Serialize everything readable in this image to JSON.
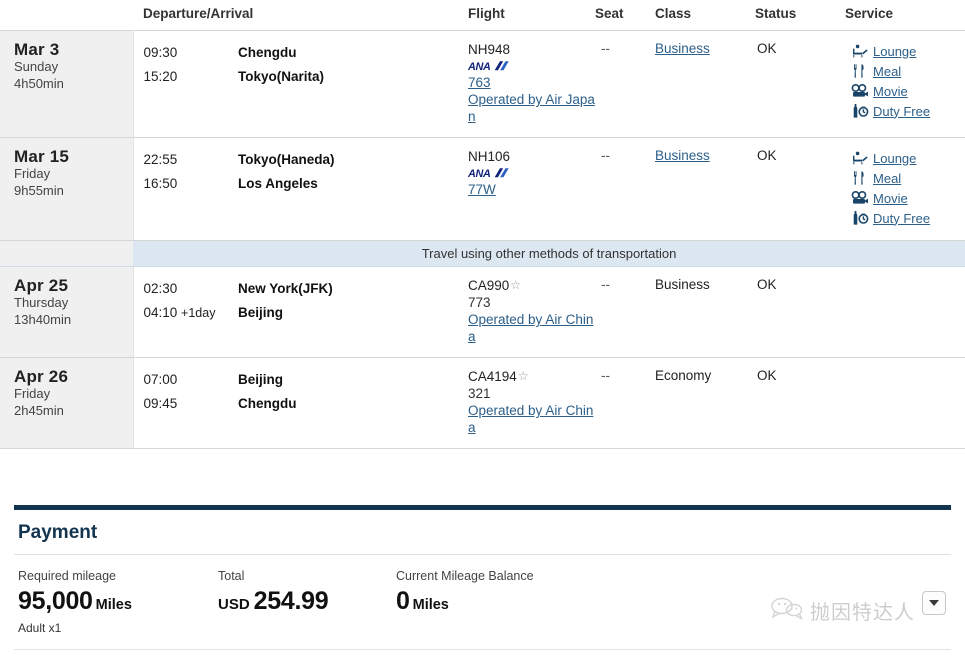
{
  "table": {
    "columns": {
      "date": "",
      "departure_arrival": "Departure/Arrival",
      "flight": "Flight",
      "seat": "Seat",
      "class": "Class",
      "status": "Status",
      "service": "Service"
    },
    "other_transport_note": "Travel using other methods of transportation",
    "segments": [
      {
        "date": "Mar 3",
        "weekday": "Sunday",
        "duration": "4h50min",
        "depart_time": "09:30",
        "arrive_time": "15:20",
        "arrive_day_offset": "",
        "depart_city": "Chengdu",
        "arrive_city": "Tokyo(Narita)",
        "flight_number": "NH948",
        "carrier_logo": "ana-logo",
        "star_alliance": false,
        "equipment": "763",
        "equipment_is_link": true,
        "operated_by": "Operated by Air Japan",
        "seat": "--",
        "class": "Business",
        "class_is_link": true,
        "status": "OK",
        "services": [
          {
            "icon": "lounge-icon",
            "label": "Lounge"
          },
          {
            "icon": "meal-icon",
            "label": "Meal"
          },
          {
            "icon": "movie-icon",
            "label": "Movie"
          },
          {
            "icon": "duty-free-icon",
            "label": "Duty Free"
          }
        ]
      },
      {
        "date": "Mar 15",
        "weekday": "Friday",
        "duration": "9h55min",
        "depart_time": "22:55",
        "arrive_time": "16:50",
        "arrive_day_offset": "",
        "depart_city": "Tokyo(Haneda)",
        "arrive_city": "Los Angeles",
        "flight_number": "NH106",
        "carrier_logo": "ana-logo",
        "star_alliance": false,
        "equipment": "77W",
        "equipment_is_link": true,
        "operated_by": "",
        "seat": "--",
        "class": "Business",
        "class_is_link": true,
        "status": "OK",
        "services": [
          {
            "icon": "lounge-icon",
            "label": "Lounge"
          },
          {
            "icon": "meal-icon",
            "label": "Meal"
          },
          {
            "icon": "movie-icon",
            "label": "Movie"
          },
          {
            "icon": "duty-free-icon",
            "label": "Duty Free"
          }
        ]
      },
      {
        "date": "Apr 25",
        "weekday": "Thursday",
        "duration": "13h40min",
        "depart_time": "02:30",
        "arrive_time": "04:10",
        "arrive_day_offset": "+1day",
        "depart_city": "New York(JFK)",
        "arrive_city": "Beijing",
        "flight_number": "CA990",
        "carrier_logo": "",
        "star_alliance": true,
        "equipment": "773",
        "equipment_is_link": false,
        "operated_by": "Operated by Air China",
        "seat": "--",
        "class": "Business",
        "class_is_link": false,
        "status": "OK",
        "services": []
      },
      {
        "date": "Apr 26",
        "weekday": "Friday",
        "duration": "2h45min",
        "depart_time": "07:00",
        "arrive_time": "09:45",
        "arrive_day_offset": "",
        "depart_city": "Beijing",
        "arrive_city": "Chengdu",
        "flight_number": "CA4194",
        "carrier_logo": "",
        "star_alliance": true,
        "equipment": "321",
        "equipment_is_link": false,
        "operated_by": "Operated by Air China",
        "seat": "--",
        "class": "Economy",
        "class_is_link": false,
        "status": "OK",
        "services": []
      }
    ]
  },
  "payment": {
    "title": "Payment",
    "required_mileage_label": "Required mileage",
    "required_mileage_value": "95,000",
    "required_mileage_unit": "Miles",
    "passengers": "Adult x1",
    "total_label": "Total",
    "total_currency": "USD",
    "total_value": "254.99",
    "current_balance_label": "Current Mileage Balance",
    "current_balance_value": "0",
    "current_balance_unit": "Miles"
  },
  "watermark": {
    "text": "抛因特达人",
    "icon": "wechat-bubble-icon"
  },
  "dropdown": {
    "icon": "chevron-down-icon"
  },
  "colors": {
    "link": "#2c5f8a",
    "navy": "#13344f",
    "band": "#dde7f2",
    "date_bg": "#f0f0f0",
    "ana_blue": "#13237b"
  }
}
